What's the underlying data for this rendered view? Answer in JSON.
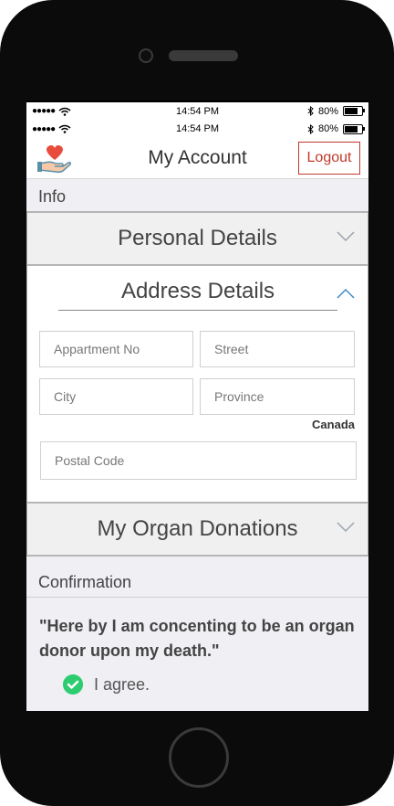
{
  "status": {
    "carrier_dots": "●●●●●",
    "time": "14:54 PM",
    "battery": "80%",
    "battery_level": 0.8
  },
  "navbar": {
    "title": "My Account",
    "logout_label": "Logout"
  },
  "info_label": "Info",
  "personal_details": {
    "label": "Personal Details"
  },
  "address_details": {
    "label": "Address Details",
    "apartment_placeholder": "Appartment No",
    "street_placeholder": "Street",
    "city_placeholder": "City",
    "province_placeholder": "Province",
    "country": "Canada",
    "postal_placeholder": "Postal Code"
  },
  "organ_donations": {
    "label": "My Organ Donations"
  },
  "confirmation": {
    "label": "Confirmation",
    "statement": "\"Here by I am concenting to be an organ donor upon my death.\"",
    "agree_label": "I agree."
  },
  "colors": {
    "logout_accent": "#c0392b",
    "check_green": "#2ecc71",
    "heart_red": "#e74c3c",
    "hand_teal": "#5a8fa8"
  }
}
